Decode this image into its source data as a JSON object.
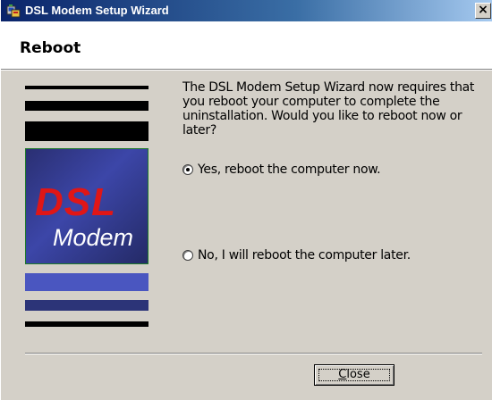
{
  "window": {
    "title": "DSL Modem Setup Wizard",
    "close_glyph": "×"
  },
  "header": {
    "title": "Reboot"
  },
  "side_panel": {
    "logo_line1": "DSL",
    "logo_line2": "Modem"
  },
  "content": {
    "message": "The DSL Modem Setup Wizard now requires that you reboot your computer to complete the uninstallation.  Would you like to reboot now or later?",
    "options": [
      {
        "label": "Yes, reboot the computer now.",
        "selected": true
      },
      {
        "label": "No, I will reboot the computer later.",
        "selected": false
      }
    ]
  },
  "buttons": {
    "close_accel": "C",
    "close_rest": "lose"
  },
  "colors": {
    "titlebar_start": "#0a246a",
    "titlebar_end": "#a6caf0",
    "face": "#d4d0c8",
    "logo_red": "#e01616",
    "logo_blue": "#3c46a8",
    "stripe_blue": "#4a56c0",
    "stripe_navy": "#2c3478"
  }
}
